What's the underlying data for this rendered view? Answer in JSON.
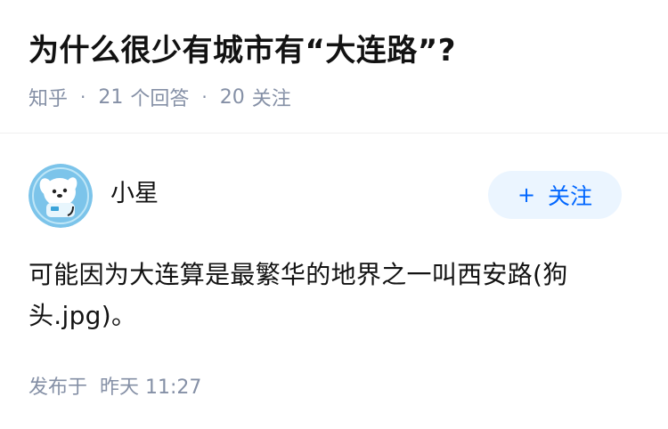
{
  "question": {
    "title": "为什么很少有城市有“大连路”?",
    "source": "知乎",
    "separator": "·",
    "answer_count": "21",
    "answer_label": "个回答",
    "follower_count": "20",
    "follower_label": "关注"
  },
  "author": {
    "name": "小星",
    "avatar_icon": "cartoon-dog-astronaut-avatar",
    "follow_button": {
      "icon": "+",
      "label": "关注"
    }
  },
  "answer": {
    "content": "可能因为大连算是最繁华的地界之一叫西安路(狗头.jpg)。",
    "published_label": "发布于",
    "published_time": "昨天 11:27"
  },
  "colors": {
    "title_text": "#121212",
    "meta_text": "#8590a6",
    "accent_blue": "#0066ff",
    "follow_button_bg": "#ebf5ff",
    "divider": "#f0f0f0",
    "avatar_bg": "#7cc4ea"
  }
}
